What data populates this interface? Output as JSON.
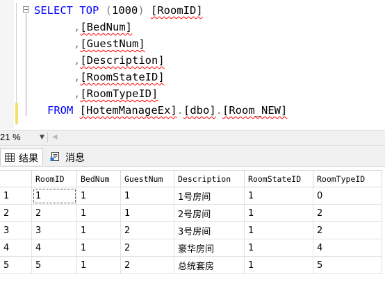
{
  "editor": {
    "lines": [
      {
        "parts": [
          {
            "t": "SELECT",
            "c": "kw"
          },
          {
            "t": " ",
            "c": "id"
          },
          {
            "t": "TOP",
            "c": "kw"
          },
          {
            "t": " (",
            "c": "gray"
          },
          {
            "t": "1000",
            "c": "id"
          },
          {
            "t": ") ",
            "c": "gray"
          },
          {
            "t": "[RoomID]",
            "c": "sq"
          }
        ]
      },
      {
        "parts": [
          {
            "t": ",",
            "c": "gray"
          },
          {
            "t": "[BedNum]",
            "c": "sq"
          }
        ]
      },
      {
        "parts": [
          {
            "t": ",",
            "c": "gray"
          },
          {
            "t": "[GuestNum]",
            "c": "sq"
          }
        ]
      },
      {
        "parts": [
          {
            "t": ",",
            "c": "gray"
          },
          {
            "t": "[Description]",
            "c": "sq"
          }
        ]
      },
      {
        "parts": [
          {
            "t": ",",
            "c": "gray"
          },
          {
            "t": "[RoomStateID]",
            "c": "sq"
          }
        ]
      },
      {
        "parts": [
          {
            "t": ",",
            "c": "gray"
          },
          {
            "t": "[RoomTypeID]",
            "c": "sq"
          }
        ]
      },
      {
        "parts": [
          {
            "t": "FROM",
            "c": "kw"
          },
          {
            "t": " ",
            "c": "id"
          },
          {
            "t": "[HotemManageEx]",
            "c": "sq"
          },
          {
            "t": ".",
            "c": "gray"
          },
          {
            "t": "[dbo]",
            "c": "sq"
          },
          {
            "t": ".",
            "c": "gray"
          },
          {
            "t": "[Room_NEW]",
            "c": "sq"
          }
        ]
      }
    ]
  },
  "status": {
    "zoom": "21 %"
  },
  "tabs": [
    {
      "label": "结果",
      "icon": "grid-icon",
      "active": true
    },
    {
      "label": "消息",
      "icon": "message-icon",
      "active": false
    }
  ],
  "grid": {
    "columns": [
      "RoomID",
      "BedNum",
      "GuestNum",
      "Description",
      "RoomStateID",
      "RoomTypeID"
    ],
    "rows": [
      {
        "n": "1",
        "cells": [
          "1",
          "1",
          "1",
          "1号房间",
          "1",
          "0"
        ]
      },
      {
        "n": "2",
        "cells": [
          "2",
          "1",
          "1",
          "2号房间",
          "1",
          "2"
        ]
      },
      {
        "n": "3",
        "cells": [
          "3",
          "1",
          "2",
          "3号房间",
          "1",
          "2"
        ]
      },
      {
        "n": "4",
        "cells": [
          "4",
          "1",
          "2",
          "豪华房间",
          "1",
          "4"
        ]
      },
      {
        "n": "5",
        "cells": [
          "5",
          "1",
          "2",
          "总统套房",
          "1",
          "5"
        ]
      }
    ]
  },
  "colors": {
    "keyword": "#0000ff",
    "squiggle": "#ff0000",
    "change_bar": "#f4e26a"
  }
}
